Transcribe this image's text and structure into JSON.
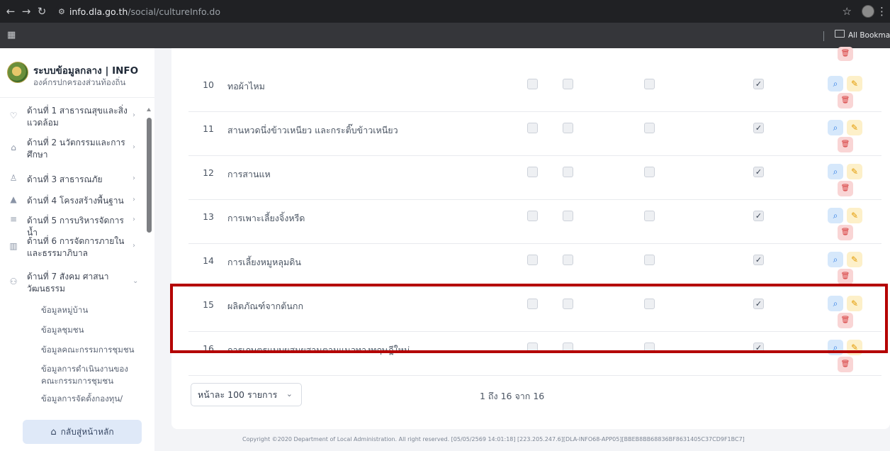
{
  "browser": {
    "url_host": "info.dla.go.th",
    "url_path": "/social/cultureInfo.do",
    "bookmark_label": "All Bookmarks"
  },
  "brand": {
    "title": "ระบบข้อมูลกลาง | INFO",
    "subtitle": "องค์กรปกครองส่วนท้องถิ่น"
  },
  "menu": [
    {
      "label": "ด้านที่ 1 สาธารณสุขและสิ่งแวดล้อม",
      "icon": "heart-icon"
    },
    {
      "label": "ด้านที่ 2 นวัตกรรมและการศึกษา",
      "icon": "school-icon"
    },
    {
      "label": "ด้านที่ 3 สาธารณภัย",
      "icon": "people-icon"
    },
    {
      "label": "ด้านที่ 4 โครงสร้างพื้นฐาน",
      "icon": "road-icon"
    },
    {
      "label": "ด้านที่ 5 การบริหารจัดการน้ำ",
      "icon": "water-icon"
    },
    {
      "label": "ด้านที่ 6 การจัดการภายในและธรรมาภิบาล",
      "icon": "building-icon"
    },
    {
      "label": "ด้านที่ 7 สังคม ศาสนา วัฒนธรรม",
      "icon": "group-icon"
    }
  ],
  "submenu": [
    "ข้อมูลหมู่บ้าน",
    "ข้อมูลชุมชน",
    "ข้อมูลคณะกรรมการชุมชน",
    "ข้อมูลการดำเนินงานของคณะกรรมการชุมชน",
    "ข้อมูลการจัดตั้งกองทุน/"
  ],
  "home_button": "กลับสู่หน้าหลัก",
  "rows": [
    {
      "num": "10",
      "name": "ทอผ้าไหม",
      "checked": [
        false,
        false,
        false,
        true
      ]
    },
    {
      "num": "11",
      "name": "สานหวดนึ่งข้าวเหนียว และกระติ๊บข้าวเหนียว",
      "checked": [
        false,
        false,
        false,
        true
      ]
    },
    {
      "num": "12",
      "name": "การสานแห",
      "checked": [
        false,
        false,
        false,
        true
      ]
    },
    {
      "num": "13",
      "name": "การเพาะเลี้ยงจิ้งหรีด",
      "checked": [
        false,
        false,
        false,
        true
      ]
    },
    {
      "num": "14",
      "name": "การเลี้ยงหมูหลุมดิน",
      "checked": [
        false,
        false,
        false,
        true
      ]
    },
    {
      "num": "15",
      "name": "ผลิตภัณฑ์จากต้นกก",
      "checked": [
        false,
        false,
        false,
        true
      ]
    },
    {
      "num": "16",
      "name": "การเกษตรแบบผสมผสานตามแนวทางทฤษฎีใหม่",
      "checked": [
        false,
        false,
        false,
        true
      ]
    }
  ],
  "pager": {
    "per_page": "หน้าละ 100 รายการ",
    "range": "1 ถึง 16 จาก 16"
  },
  "footer": "Copyright ©2020 Department of Local Administration. All right reserved. [05/05/2569 14:01:18] [223.205.247.6][DLA-INFO68-APP05][BBEB8BB68836BF8631405C37CD9F1BC7]",
  "highlight_color": "#b40000"
}
